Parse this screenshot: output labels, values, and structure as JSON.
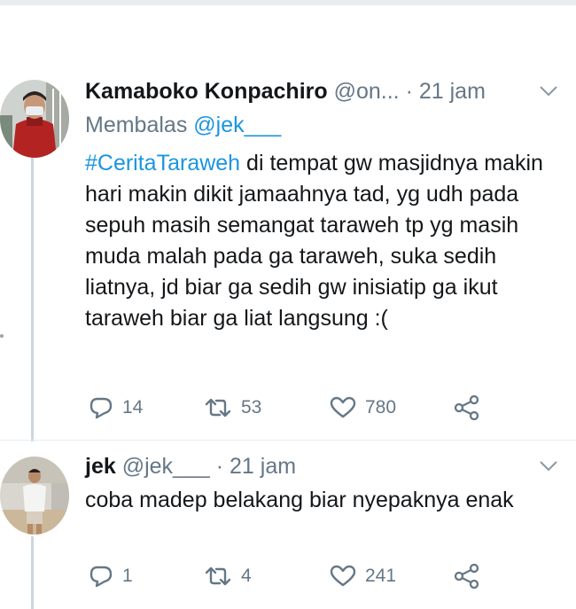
{
  "tweet1": {
    "display_name": "Kamaboko Konpachiro",
    "handle": "@on...",
    "separator": "·",
    "time": "21 jam",
    "reply_prefix": "Membalas",
    "reply_handle": "@jek___",
    "hashtag": "#CeritaTaraweh",
    "text_after_hashtag": " di tempat gw masjidnya makin hari makin dikit jamaahnya tad, yg udh pada sepuh masih semangat taraweh tp yg masih muda malah pada ga taraweh, suka sedih liatnya, jd biar ga sedih gw inisiatip ga ikut taraweh biar ga liat langsung :(",
    "replies": "14",
    "retweets": "53",
    "likes": "780"
  },
  "tweet2": {
    "display_name": "jek",
    "handle": "@jek___",
    "separator": "·",
    "time": "21 jam",
    "text": "coba madep belakang biar nyepaknya enak",
    "replies": "1",
    "retweets": "4",
    "likes": "241"
  },
  "colors": {
    "link": "#1b95e0",
    "secondary_text": "#657786",
    "primary_text": "#14171a",
    "thread_line": "#ccd6dd"
  },
  "icons": [
    "reply-icon",
    "retweet-icon",
    "like-icon",
    "share-icon",
    "chevron-down-icon"
  ]
}
